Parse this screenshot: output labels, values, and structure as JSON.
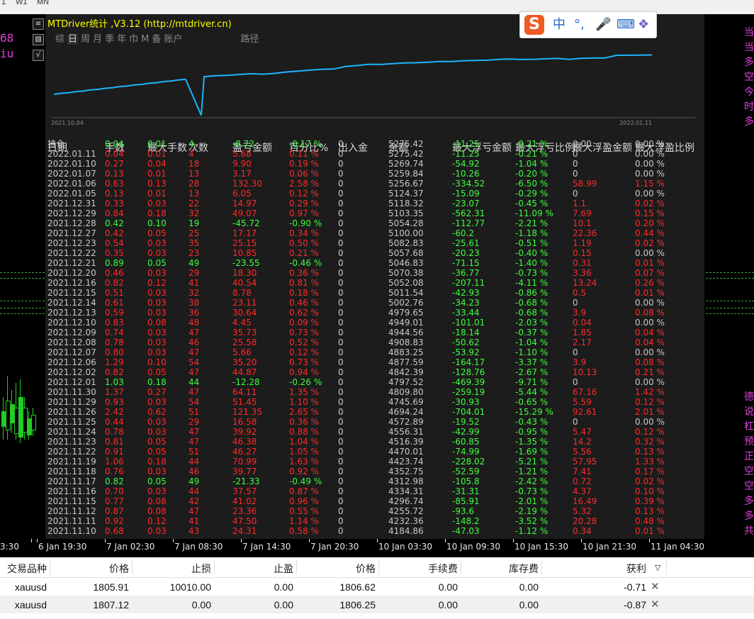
{
  "toolbar": {
    "timeframes": [
      "1",
      "W1",
      "MN"
    ]
  },
  "chart": {
    "left_texts": [
      "68",
      "iu"
    ],
    "right_vertical_texts": [
      "当当多空今时多",
      "德说杠预正空空多多共"
    ],
    "x_axis_labels": [
      "3:30",
      "6 Jan 19:30",
      "7 Jan 02:30",
      "7 Jan 08:30",
      "7 Jan 14:30",
      "7 Jan 20:30",
      "10 Jan 03:30",
      "10 Jan 09:30",
      "10 Jan 15:30",
      "10 Jan 21:30",
      "11 Jan 04:30"
    ]
  },
  "panel": {
    "title": "MTDriver统计 ,V3.12 (http://mtdriver.cn)",
    "tabs": [
      "综",
      "日",
      "周",
      "月",
      "季",
      "年",
      "巾",
      "M",
      "备",
      "账户"
    ],
    "selected_tab": "日",
    "path_tab": "路径",
    "graph_start": "2021.10.04",
    "graph_end": "2022.01.11",
    "columns": [
      "日期",
      "手数",
      "最大手数",
      "次数",
      "盈亏金额",
      "百分比%",
      "出入金",
      "余额",
      "最大浮亏金额",
      "最大浮亏比例",
      "最大浮盈金额",
      "最大浮盈比例"
    ],
    "rows": [
      [
        "持仓",
        "0.04",
        "0.01",
        "4",
        "-8.72",
        "-0.17 %",
        "0",
        "5275.42",
        "-11.25",
        "-0.21 %",
        "0.00",
        "0.00 %"
      ],
      [
        "2022.01.11",
        "0.04",
        "0.01",
        "4",
        "5.68",
        "0.11 %",
        "0",
        "5275.42",
        "-11.25",
        "-0.21 %",
        "0",
        "0.00 %"
      ],
      [
        "2022.01.10",
        "0.27",
        "0.04",
        "18",
        "9.90",
        "0.19 %",
        "0",
        "5269.74",
        "-54.92",
        "-1.04 %",
        "0",
        "0.00 %"
      ],
      [
        "2022.01.07",
        "0.13",
        "0.01",
        "13",
        "3.17",
        "0.06 %",
        "0",
        "5259.84",
        "-10.26",
        "-0.20 %",
        "0",
        "0.00 %"
      ],
      [
        "2022.01.06",
        "0.63",
        "0.13",
        "28",
        "132.30",
        "2.58 %",
        "0",
        "5256.67",
        "-334.52",
        "-6.50 %",
        "58.99",
        "1.15 %"
      ],
      [
        "2022.01.05",
        "0.13",
        "0.01",
        "13",
        "6.05",
        "0.12 %",
        "0",
        "5124.37",
        "-15.09",
        "-0.29 %",
        "0",
        "0.00 %"
      ],
      [
        "2021.12.31",
        "0.33",
        "0.03",
        "22",
        "14.97",
        "0.29 %",
        "0",
        "5118.32",
        "-23.07",
        "-0.45 %",
        "1.1",
        "0.02 %"
      ],
      [
        "2021.12.29",
        "0.84",
        "0.18",
        "32",
        "49.07",
        "0.97 %",
        "0",
        "5103.35",
        "-562.31",
        "-11.09 %",
        "7.69",
        "0.15 %"
      ],
      [
        "2021.12.28",
        "0.42",
        "0.10",
        "19",
        "-45.72",
        "-0.90 %",
        "0",
        "5054.28",
        "-112.77",
        "-2.21 %",
        "10.1",
        "0.20 %"
      ],
      [
        "2021.12.27",
        "0.42",
        "0.05",
        "25",
        "17.17",
        "0.34 %",
        "0",
        "5100.00",
        "-60.2",
        "-1.18 %",
        "22.36",
        "0.44 %"
      ],
      [
        "2021.12.23",
        "0.54",
        "0.03",
        "35",
        "25.15",
        "0.50 %",
        "0",
        "5082.83",
        "-25.61",
        "-0.51 %",
        "1.19",
        "0.02 %"
      ],
      [
        "2021.12.22",
        "0.35",
        "0.03",
        "23",
        "10.85",
        "0.21 %",
        "0",
        "5057.68",
        "-20.23",
        "-0.40 %",
        "0.15",
        "0.00 %"
      ],
      [
        "2021.12.21",
        "0.89",
        "0.05",
        "49",
        "-23.55",
        "-0.46 %",
        "0",
        "5046.83",
        "-71.15",
        "-1.40 %",
        "0.31",
        "0.01 %"
      ],
      [
        "2021.12.20",
        "0.46",
        "0.03",
        "29",
        "18.30",
        "0.36 %",
        "0",
        "5070.38",
        "-36.77",
        "-0.73 %",
        "3.36",
        "0.07 %"
      ],
      [
        "2021.12.16",
        "0.82",
        "0.12",
        "41",
        "40.54",
        "0.81 %",
        "0",
        "5052.08",
        "-207.11",
        "-4.11 %",
        "13.24",
        "0.26 %"
      ],
      [
        "2021.12.15",
        "0.51",
        "0.03",
        "32",
        "8.78",
        "0.18 %",
        "0",
        "5011.54",
        "-42.93",
        "-0.86 %",
        "0.5",
        "0.01 %"
      ],
      [
        "2021.12.14",
        "0.61",
        "0.03",
        "38",
        "23.11",
        "0.46 %",
        "0",
        "5002.76",
        "-34.23",
        "-0.68 %",
        "0",
        "0.00 %"
      ],
      [
        "2021.12.13",
        "0.59",
        "0.03",
        "36",
        "30.64",
        "0.62 %",
        "0",
        "4979.65",
        "-33.44",
        "-0.68 %",
        "3.9",
        "0.08 %"
      ],
      [
        "2021.12.10",
        "0.83",
        "0.08",
        "48",
        "4.45",
        "0.09 %",
        "0",
        "4949.01",
        "-101.01",
        "-2.03 %",
        "0.04",
        "0.00 %"
      ],
      [
        "2021.12.09",
        "0.74",
        "0.03",
        "47",
        "35.73",
        "0.73 %",
        "0",
        "4944.56",
        "-18.14",
        "-0.37 %",
        "1.85",
        "0.04 %"
      ],
      [
        "2021.12.08",
        "0.78",
        "0.03",
        "46",
        "25.58",
        "0.52 %",
        "0",
        "4908.83",
        "-50.62",
        "-1.04 %",
        "2.17",
        "0.04 %"
      ],
      [
        "2021.12.07",
        "0.80",
        "0.03",
        "47",
        "5.66",
        "0.12 %",
        "0",
        "4883.25",
        "-53.92",
        "-1.10 %",
        "0",
        "0.00 %"
      ],
      [
        "2021.12.06",
        "1.29",
        "0.10",
        "54",
        "35.20",
        "0.73 %",
        "0",
        "4877.59",
        "-164.17",
        "-3.37 %",
        "3.9",
        "0.08 %"
      ],
      [
        "2021.12.02",
        "0.82",
        "0.05",
        "47",
        "44.87",
        "0.94 %",
        "0",
        "4842.39",
        "-128.76",
        "-2.67 %",
        "10.13",
        "0.21 %"
      ],
      [
        "2021.12.01",
        "1.03",
        "0.18",
        "44",
        "-12.28",
        "-0.26 %",
        "0",
        "4797.52",
        "-469.39",
        "-9.71 %",
        "0",
        "0.00 %"
      ],
      [
        "2021.11.30",
        "1.37",
        "0.27",
        "47",
        "64.11",
        "1.35 %",
        "0",
        "4809.80",
        "-259.19",
        "-5.44 %",
        "67.16",
        "1.42 %"
      ],
      [
        "2021.11.29",
        "0.93",
        "0.03",
        "54",
        "51.45",
        "1.10 %",
        "0",
        "4745.69",
        "-30.93",
        "-0.65 %",
        "5.59",
        "0.12 %"
      ],
      [
        "2021.11.26",
        "2.42",
        "0.62",
        "51",
        "121.35",
        "2.65 %",
        "0",
        "4694.24",
        "-704.01",
        "-15.29 %",
        "92.61",
        "2.01 %"
      ],
      [
        "2021.11.25",
        "0.44",
        "0.03",
        "29",
        "16.58",
        "0.36 %",
        "0",
        "4572.89",
        "-19.52",
        "-0.43 %",
        "0",
        "0.00 %"
      ],
      [
        "2021.11.24",
        "0.78",
        "0.03",
        "47",
        "39.92",
        "0.88 %",
        "0",
        "4556.31",
        "-42.99",
        "-0.95 %",
        "5.47",
        "0.12 %"
      ],
      [
        "2021.11.23",
        "0.81",
        "0.05",
        "47",
        "46.38",
        "1.04 %",
        "0",
        "4516.39",
        "-60.85",
        "-1.35 %",
        "14.2",
        "0.32 %"
      ],
      [
        "2021.11.22",
        "0.91",
        "0.05",
        "51",
        "46.27",
        "1.05 %",
        "0",
        "4470.01",
        "-74.99",
        "-1.69 %",
        "5.56",
        "0.13 %"
      ],
      [
        "2021.11.19",
        "1.06",
        "0.18",
        "44",
        "70.99",
        "1.63 %",
        "0",
        "4423.74",
        "-228.02",
        "-5.21 %",
        "57.95",
        "1.33 %"
      ],
      [
        "2021.11.18",
        "0.76",
        "0.03",
        "46",
        "39.77",
        "0.92 %",
        "0",
        "4352.75",
        "-52.59",
        "-1.21 %",
        "7.41",
        "0.17 %"
      ],
      [
        "2021.11.17",
        "0.82",
        "0.05",
        "49",
        "-21.33",
        "-0.49 %",
        "0",
        "4312.98",
        "-105.8",
        "-2.42 %",
        "0.72",
        "0.02 %"
      ],
      [
        "2021.11.16",
        "0.70",
        "0.03",
        "44",
        "37.57",
        "0.87 %",
        "0",
        "4334.31",
        "-31.31",
        "-0.73 %",
        "4.37",
        "0.10 %"
      ],
      [
        "2021.11.15",
        "0.77",
        "0.08",
        "42",
        "41.02",
        "0.96 %",
        "0",
        "4296.74",
        "-85.91",
        "-2.01 %",
        "16.49",
        "0.39 %"
      ],
      [
        "2021.11.12",
        "0.87",
        "0.08",
        "47",
        "23.36",
        "0.55 %",
        "0",
        "4255.72",
        "-93.6",
        "-2.19 %",
        "5.32",
        "0.13 %"
      ],
      [
        "2021.11.11",
        "0.92",
        "0.12",
        "41",
        "47.50",
        "1.14 %",
        "0",
        "4232.36",
        "-148.2",
        "-3.52 %",
        "20.28",
        "0.48 %"
      ],
      [
        "2021.11.10",
        "0.68",
        "0.03",
        "43",
        "24.31",
        "0.58 %",
        "0",
        "4184.86",
        "-47.03",
        "-1.12 %",
        "0.34",
        "0.01 %"
      ]
    ]
  },
  "ime": {
    "logo": "S",
    "items": [
      "中",
      "°,",
      "🎤",
      "⌨",
      "❖"
    ]
  },
  "terminal": {
    "columns": [
      "交易品种",
      "价格",
      "止损",
      "止盈",
      "价格",
      "手续费",
      "库存费",
      "获利"
    ],
    "sort_icon": "▽",
    "rows": [
      [
        "xauusd",
        "1805.91",
        "10010.00",
        "0.00",
        "1806.62",
        "0.00",
        "0.00",
        "-0.71"
      ],
      [
        "xauusd",
        "1807.12",
        "0.00",
        "0.00",
        "1806.25",
        "0.00",
        "0.00",
        "-0.87"
      ]
    ]
  },
  "colors": {
    "positive": "#ff2a2a",
    "negative": "#3cff3c",
    "neutral": "#c8c8c8",
    "title": "#ffff00",
    "curve": "#1eb4ff",
    "accent": "#e040e0"
  }
}
